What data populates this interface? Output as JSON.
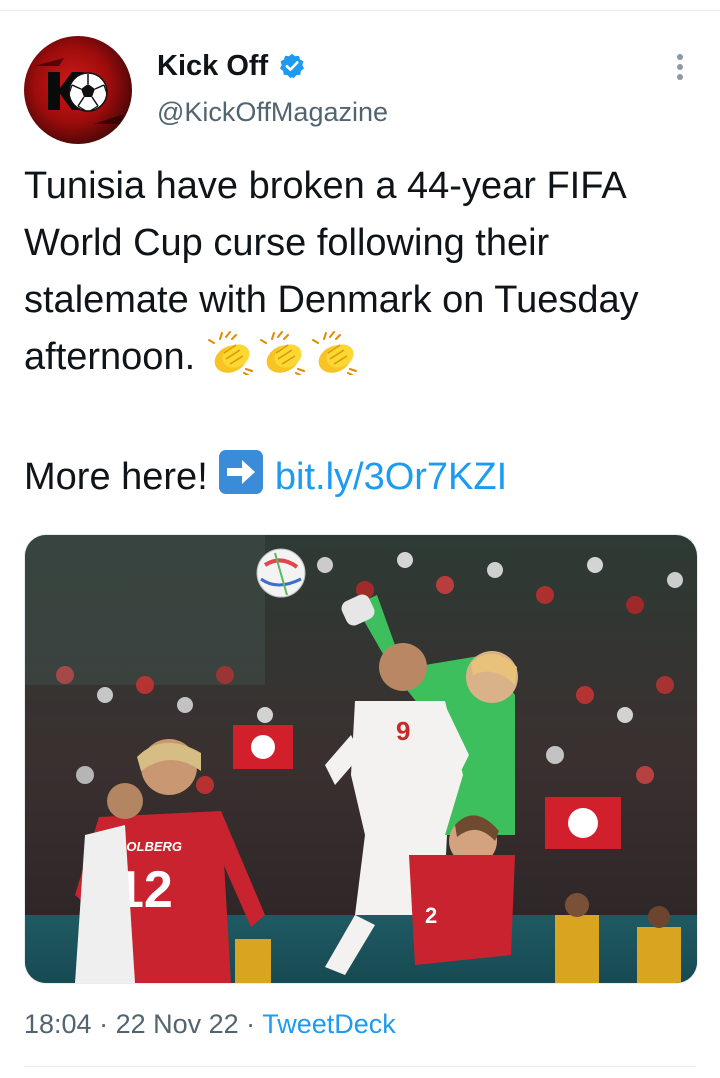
{
  "account": {
    "display_name": "Kick Off",
    "handle": "@KickOffMagazine",
    "verified": true,
    "avatar_logo_letter": "K"
  },
  "tweet": {
    "text_main": "Tunisia have broken a 44-year FIFA World Cup curse following their stalemate with Denmark on Tuesday afternoon. ",
    "emoji": [
      "clapping-hands",
      "clapping-hands",
      "clapping-hands"
    ],
    "more_prefix": "More here! ",
    "link_icon": "right-arrow-button-icon",
    "link_text": "bit.ly/3Or7KZI"
  },
  "media": {
    "description_icon": "football-match-photo",
    "jersey_name": "DOLBERG",
    "jersey_number": "12",
    "tunisia_number": "9",
    "denmark_back_number": "2"
  },
  "meta": {
    "time": "18:04",
    "sep1": " · ",
    "date": "22 Nov 22",
    "sep2": " · ",
    "source": "TweetDeck"
  },
  "colors": {
    "link": "#1d9bf0",
    "secondary_text": "#536471",
    "verified_badge": "#1d9bf0",
    "divider": "#e6ecf0"
  }
}
